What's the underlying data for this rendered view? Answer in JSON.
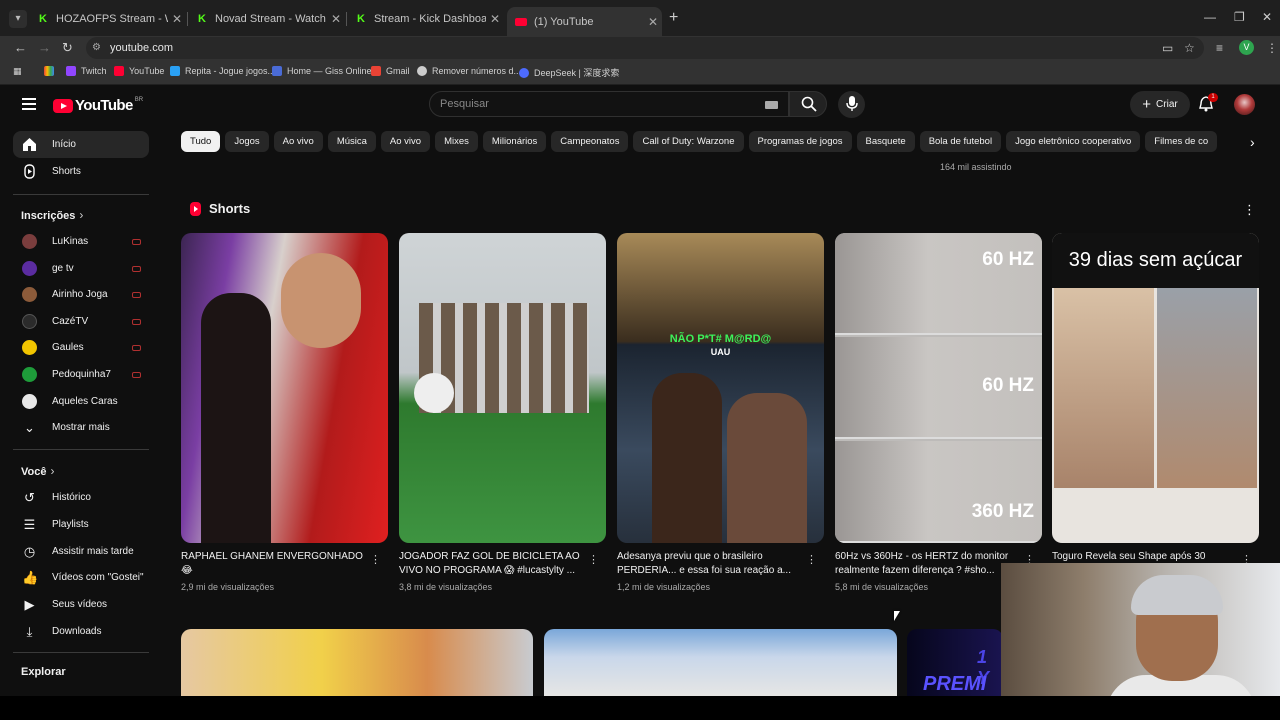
{
  "browser": {
    "tabs": [
      {
        "label": "HOZAOFPS Stream - Watch Liv",
        "icon": "kick-icon"
      },
      {
        "label": "Novad Stream - Watch Live on",
        "icon": "kick-icon"
      },
      {
        "label": "Stream - Kick Dashboard",
        "icon": "kick-icon"
      },
      {
        "label": "(1) YouTube",
        "icon": "youtube-icon",
        "active": true
      }
    ],
    "url": "youtube.com",
    "profile_initial": "V",
    "bookmarks": [
      {
        "label": "Twitch",
        "color": "#9146ff"
      },
      {
        "label": "YouTube",
        "color": "#ff0033"
      },
      {
        "label": "Repita - Jogue jogos...",
        "color": "#2aa1f5"
      },
      {
        "label": "Home — Giss Online",
        "color": "#4a6bd6"
      },
      {
        "label": "Gmail",
        "color": "#ea4335"
      },
      {
        "label": "Remover números d...",
        "color": "#cccccc"
      },
      {
        "label": "DeepSeek | 深度求索",
        "color": "#4d6bfe"
      }
    ]
  },
  "header": {
    "logo_text": "YouTube",
    "country_code": "BR",
    "search_placeholder": "Pesquisar",
    "create_label": "Criar",
    "notification_count": "1"
  },
  "sidebar": {
    "main": [
      {
        "label": "Início",
        "icon": "home-icon",
        "active": true
      },
      {
        "label": "Shorts",
        "icon": "shorts-icon"
      }
    ],
    "subscriptions_title": "Inscrições",
    "subscriptions": [
      {
        "label": "LuKinas",
        "color": "#7a3d3d"
      },
      {
        "label": "ge tv",
        "color": "#5b2ca0"
      },
      {
        "label": "Airinho Joga",
        "color": "#8c5b3a"
      },
      {
        "label": "CazéTV",
        "color": "#2b2b2b"
      },
      {
        "label": "Gaules",
        "color": "#f2c500"
      },
      {
        "label": "Pedoquinha7",
        "color": "#1e9c3a"
      },
      {
        "label": "Aqueles Caras",
        "color": "#e8e8e8"
      }
    ],
    "show_more": "Mostrar mais",
    "you_title": "Você",
    "you": [
      {
        "label": "Histórico",
        "icon": "history-icon"
      },
      {
        "label": "Playlists",
        "icon": "playlist-icon"
      },
      {
        "label": "Assistir mais tarde",
        "icon": "watch-later-icon"
      },
      {
        "label": "Vídeos com \"Gostei\"",
        "icon": "like-icon"
      },
      {
        "label": "Seus vídeos",
        "icon": "your-videos-icon"
      },
      {
        "label": "Downloads",
        "icon": "download-icon"
      }
    ],
    "explore_title": "Explorar"
  },
  "chips": [
    "Tudo",
    "Jogos",
    "Ao vivo",
    "Música",
    "Ao vivo",
    "Mixes",
    "Milionários",
    "Campeonatos",
    "Call of Duty: Warzone",
    "Programas de jogos",
    "Basquete",
    "Bola de futebol",
    "Jogo eletrônico cooperativo",
    "Filmes de co"
  ],
  "viewers_above": "164 mil assistindo",
  "shorts": {
    "title": "Shorts",
    "items": [
      {
        "title": "RAPHAEL GHANEM ENVERGONHADO 😂",
        "views": "2,9 mi de visualizações"
      },
      {
        "title": "JOGADOR FAZ GOL DE BICICLETA AO VIVO NO PROGRAMA 😱 #lucastylty ...",
        "views": "3,8 mi de visualizações"
      },
      {
        "title": "Adesanya previu que o brasileiro PERDERIA... e essa foi sua reação a...",
        "views": "1,2 mi de visualizações",
        "overlay": "NÃO P*T# M@RD@",
        "overlay2": "UAU"
      },
      {
        "title": "60Hz vs 360Hz - os HERTZ do monitor realmente fazem diferença ? #sho...",
        "views": "5,8 mi de visualizações",
        "labels": [
          "60 HZ",
          "60 HZ",
          "360 HZ"
        ]
      },
      {
        "title": "Toguro Revela seu Shape após 30",
        "views": "",
        "overlay": "39 dias sem açúcar"
      }
    ]
  },
  "row2_badge": "PREMI",
  "row2_badge_num": "1 Y"
}
